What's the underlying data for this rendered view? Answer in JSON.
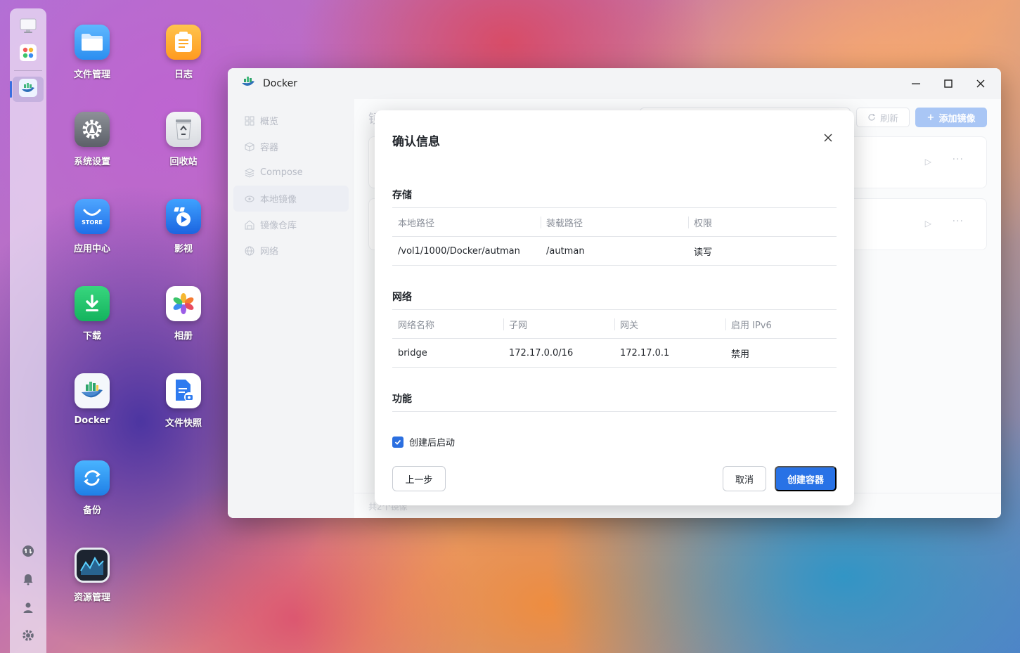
{
  "desktop": {
    "icons": [
      {
        "label": "文件管理",
        "icon": "folder-icon"
      },
      {
        "label": "日志",
        "icon": "notepad-icon"
      },
      {
        "label": "系统设置",
        "icon": "settings-gear-icon"
      },
      {
        "label": "回收站",
        "icon": "recycle-bin-icon"
      },
      {
        "label": "应用中心",
        "icon": "store-icon",
        "tile_text": "STORE"
      },
      {
        "label": "影视",
        "icon": "video-player-icon"
      },
      {
        "label": "下载",
        "icon": "download-icon"
      },
      {
        "label": "相册",
        "icon": "photos-icon"
      },
      {
        "label": "Docker",
        "icon": "docker-whale-icon"
      },
      {
        "label": "文件快照",
        "icon": "file-snapshot-icon"
      },
      {
        "label": "备份",
        "icon": "backup-icon"
      },
      {
        "label": "资源管理",
        "icon": "resource-monitor-icon"
      }
    ]
  },
  "dock": {
    "top": [
      "monitor-icon",
      "apps-grid-icon"
    ],
    "running": [
      "docker-whale-icon"
    ],
    "bottom": [
      "sync-icon",
      "bell-icon",
      "user-icon",
      "gear-icon"
    ]
  },
  "window": {
    "title": "Docker",
    "sidebar": [
      {
        "label": "概览",
        "icon": "overview-grid-icon"
      },
      {
        "label": "容器",
        "icon": "cube-icon"
      },
      {
        "label": "Compose",
        "icon": "layers-icon"
      },
      {
        "label": "本地镜像",
        "icon": "disk-icon",
        "active": true
      },
      {
        "label": "镜像仓库",
        "icon": "warehouse-icon"
      },
      {
        "label": "网络",
        "icon": "globe-icon"
      }
    ],
    "main": {
      "heading_partial": "镜",
      "refresh_label": "刷新",
      "add_image_label": "添加镜像",
      "footer_partial": "共2个镜像"
    }
  },
  "modal": {
    "title": "确认信息",
    "storage": {
      "title": "存储",
      "headers": [
        "本地路径",
        "装载路径",
        "权限"
      ],
      "rows": [
        [
          "/vol1/1000/Docker/autman",
          "/autman",
          "读写"
        ]
      ]
    },
    "network": {
      "title": "网络",
      "headers": [
        "网络名称",
        "子网",
        "网关",
        "启用 IPv6"
      ],
      "rows": [
        [
          "bridge",
          "172.17.0.0/16",
          "172.17.0.1",
          "禁用"
        ]
      ]
    },
    "features": {
      "title": "功能"
    },
    "start_after_create": {
      "label": "创建后启动",
      "checked": true
    },
    "buttons": {
      "prev": "上一步",
      "cancel": "取消",
      "create": "创建容器"
    }
  }
}
